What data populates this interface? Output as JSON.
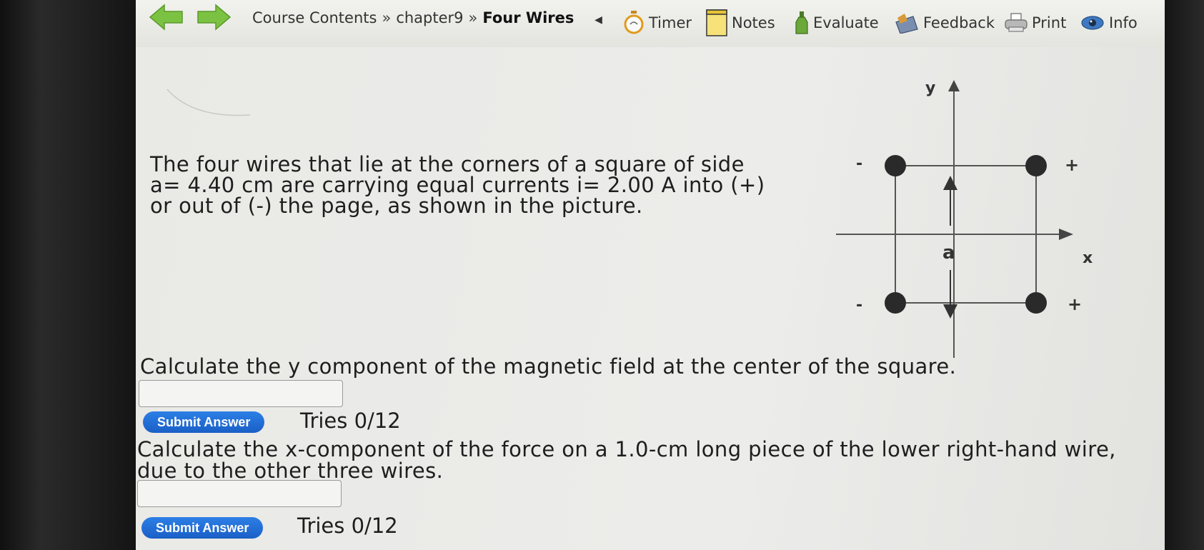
{
  "breadcrumb": {
    "items": [
      "Course Contents",
      "chapter9",
      "Four Wires"
    ],
    "separator": "»"
  },
  "toolbar": {
    "timer": "Timer",
    "notes": "Notes",
    "evaluate": "Evaluate",
    "feedback": "Feedback",
    "print": "Print",
    "info": "Info"
  },
  "problem": {
    "text": "The four wires that lie at the corners of a square of side a= 4.40 cm are carrying equal currents i= 2.00 A into (+) or out of (-) the page, as shown in the picture."
  },
  "diagram": {
    "y_label": "y",
    "x_label": "x",
    "side_label": "a",
    "top_left_sign": "-",
    "top_right_sign": "+",
    "bottom_left_sign": "-",
    "bottom_right_sign": "+"
  },
  "questions": [
    {
      "prompt": "Calculate the y component of the magnetic field at the center of the square.",
      "answer_value": "",
      "submit_label": "Submit Answer",
      "tries": "Tries 0/12"
    },
    {
      "prompt": "Calculate the x-component of the force on a 1.0-cm long piece of the lower right-hand wire, due to the other three wires.",
      "answer_value": "",
      "submit_label": "Submit Answer",
      "tries": "Tries 0/12"
    }
  ],
  "colors": {
    "nav_arrow": "#7cc242",
    "submit_button": "#1f6bd6"
  }
}
